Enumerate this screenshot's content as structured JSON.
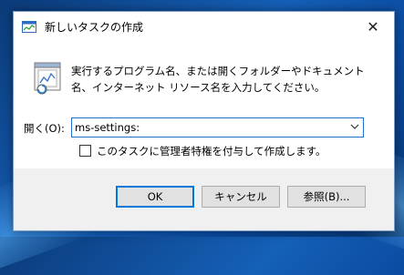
{
  "window": {
    "title": "新しいタスクの作成",
    "close_glyph": "✕"
  },
  "dialog": {
    "description": "実行するプログラム名、または開くフォルダーやドキュメント名、インターネット リソース名を入力してください。",
    "open_label": "開く(O):",
    "open_value": "ms-settings:",
    "admin_checkbox": {
      "label": "このタスクに管理者特権を付与して作成します。",
      "checked": false
    }
  },
  "buttons": {
    "ok": "OK",
    "cancel": "キャンセル",
    "browse": "参照(B)..."
  },
  "colors": {
    "accent": "#0078d7",
    "combo_border": "#1e6fd0"
  }
}
